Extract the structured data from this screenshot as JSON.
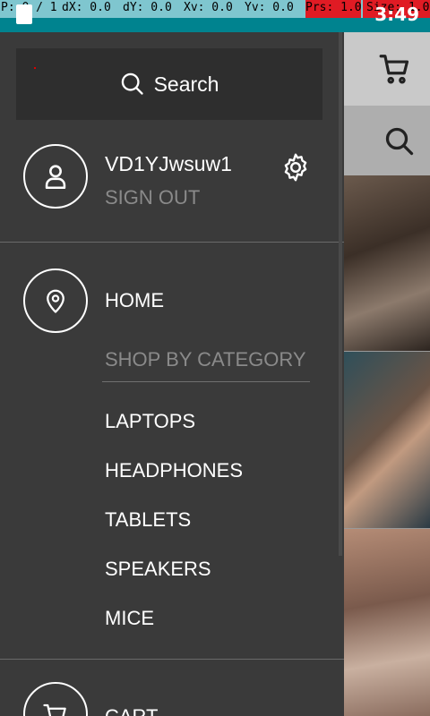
{
  "debug": {
    "p": "P: 0 / 1",
    "dx": "dX: 0.0",
    "dy": "dY: 0.0",
    "xv": "Xv: 0.0",
    "yv": "Yv: 0.0",
    "prs": "Prs: 1.0",
    "size": "Size: 1.0"
  },
  "status": {
    "time": "3:49"
  },
  "drawer": {
    "search_label": "Search",
    "username": "VD1YJwsuw1",
    "sign_out": "SIGN OUT",
    "home": "HOME",
    "shop_by_category": "SHOP BY CATEGORY",
    "categories": [
      "LAPTOPS",
      "HEADPHONES",
      "TABLETS",
      "SPEAKERS",
      "MICE"
    ],
    "cart": "CART"
  },
  "icons": [
    "search-icon",
    "user-icon",
    "gear-icon",
    "location-pin-icon",
    "cart-icon"
  ],
  "colors": {
    "drawer_bg": "#3a3a3a",
    "search_bg": "#2e2e2e",
    "status_bar": "#00838f",
    "debug_bar": "#7fc6cf",
    "debug_alert": "#e01b24",
    "muted_text": "#8a8a8a"
  }
}
